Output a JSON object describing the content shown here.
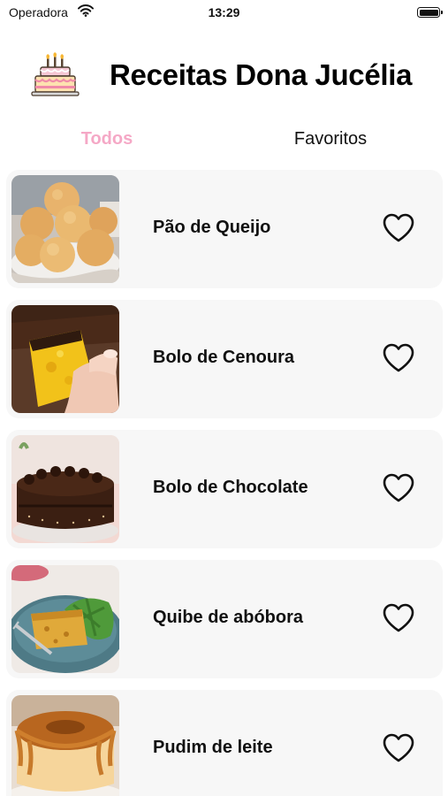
{
  "status_bar": {
    "carrier": "Operadora",
    "time": "13:29",
    "wifi_icon": "wifi-icon",
    "battery_icon": "battery-icon"
  },
  "header": {
    "title": "Receitas Dona Jucélia",
    "logo_icon": "birthday-cake-icon"
  },
  "tabs": [
    {
      "label": "Todos",
      "active": true
    },
    {
      "label": "Favoritos",
      "active": false
    }
  ],
  "recipes": [
    {
      "name": "Pão de Queijo",
      "favorite": false,
      "photo": "cheese-bread-photo"
    },
    {
      "name": "Bolo de Cenoura",
      "favorite": false,
      "photo": "carrot-cake-photo"
    },
    {
      "name": "Bolo de Chocolate",
      "favorite": false,
      "photo": "chocolate-cake-photo"
    },
    {
      "name": "Quibe de abóbora",
      "favorite": false,
      "photo": "pumpkin-kibbeh-photo"
    },
    {
      "name": "Pudim de leite",
      "favorite": false,
      "photo": "milk-pudding-photo"
    }
  ],
  "colors": {
    "active_tab": "#f5a8c6",
    "card_background": "#f7f7f7",
    "text": "#111111"
  }
}
